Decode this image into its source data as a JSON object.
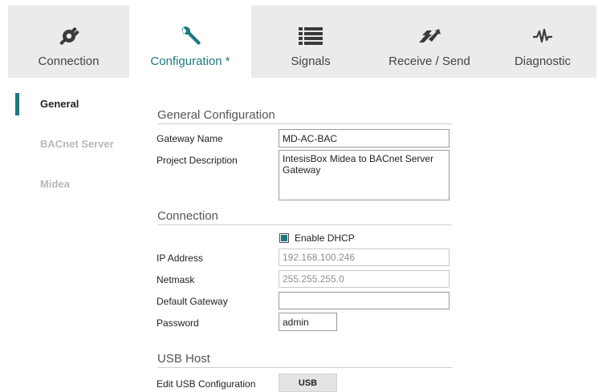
{
  "tabs": [
    {
      "label": "Connection",
      "icon": "plug-icon"
    },
    {
      "label": "Configuration *",
      "icon": "wrench-icon",
      "active": true
    },
    {
      "label": "Signals",
      "icon": "list-icon"
    },
    {
      "label": "Receive / Send",
      "icon": "transfer-icon"
    },
    {
      "label": "Diagnostic",
      "icon": "pulse-icon"
    }
  ],
  "sidebar": {
    "items": [
      {
        "label": "General",
        "active": true
      },
      {
        "label": "BACnet Server"
      },
      {
        "label": "Midea"
      }
    ]
  },
  "general": {
    "title": "General Configuration",
    "gateway_name_label": "Gateway Name",
    "gateway_name_value": "MD-AC-BAC",
    "project_description_label": "Project Description",
    "project_description_value": "IntesisBox Midea to BACnet Server Gateway"
  },
  "connection": {
    "title": "Connection",
    "dhcp_label": "Enable DHCP",
    "dhcp_checked": true,
    "ip_label": "IP Address",
    "ip_value": "192.168.100.246",
    "netmask_label": "Netmask",
    "netmask_value": "255.255.255.0",
    "gateway_label": "Default Gateway",
    "gateway_value": "",
    "password_label": "Password",
    "password_value": "admin"
  },
  "usb": {
    "title": "USB Host",
    "edit_label": "Edit USB Configuration",
    "button_label": "USB"
  },
  "colors": {
    "accent": "#1b7a80",
    "tab_bg": "#ebebeb",
    "disabled_text": "#b8b8b8"
  }
}
